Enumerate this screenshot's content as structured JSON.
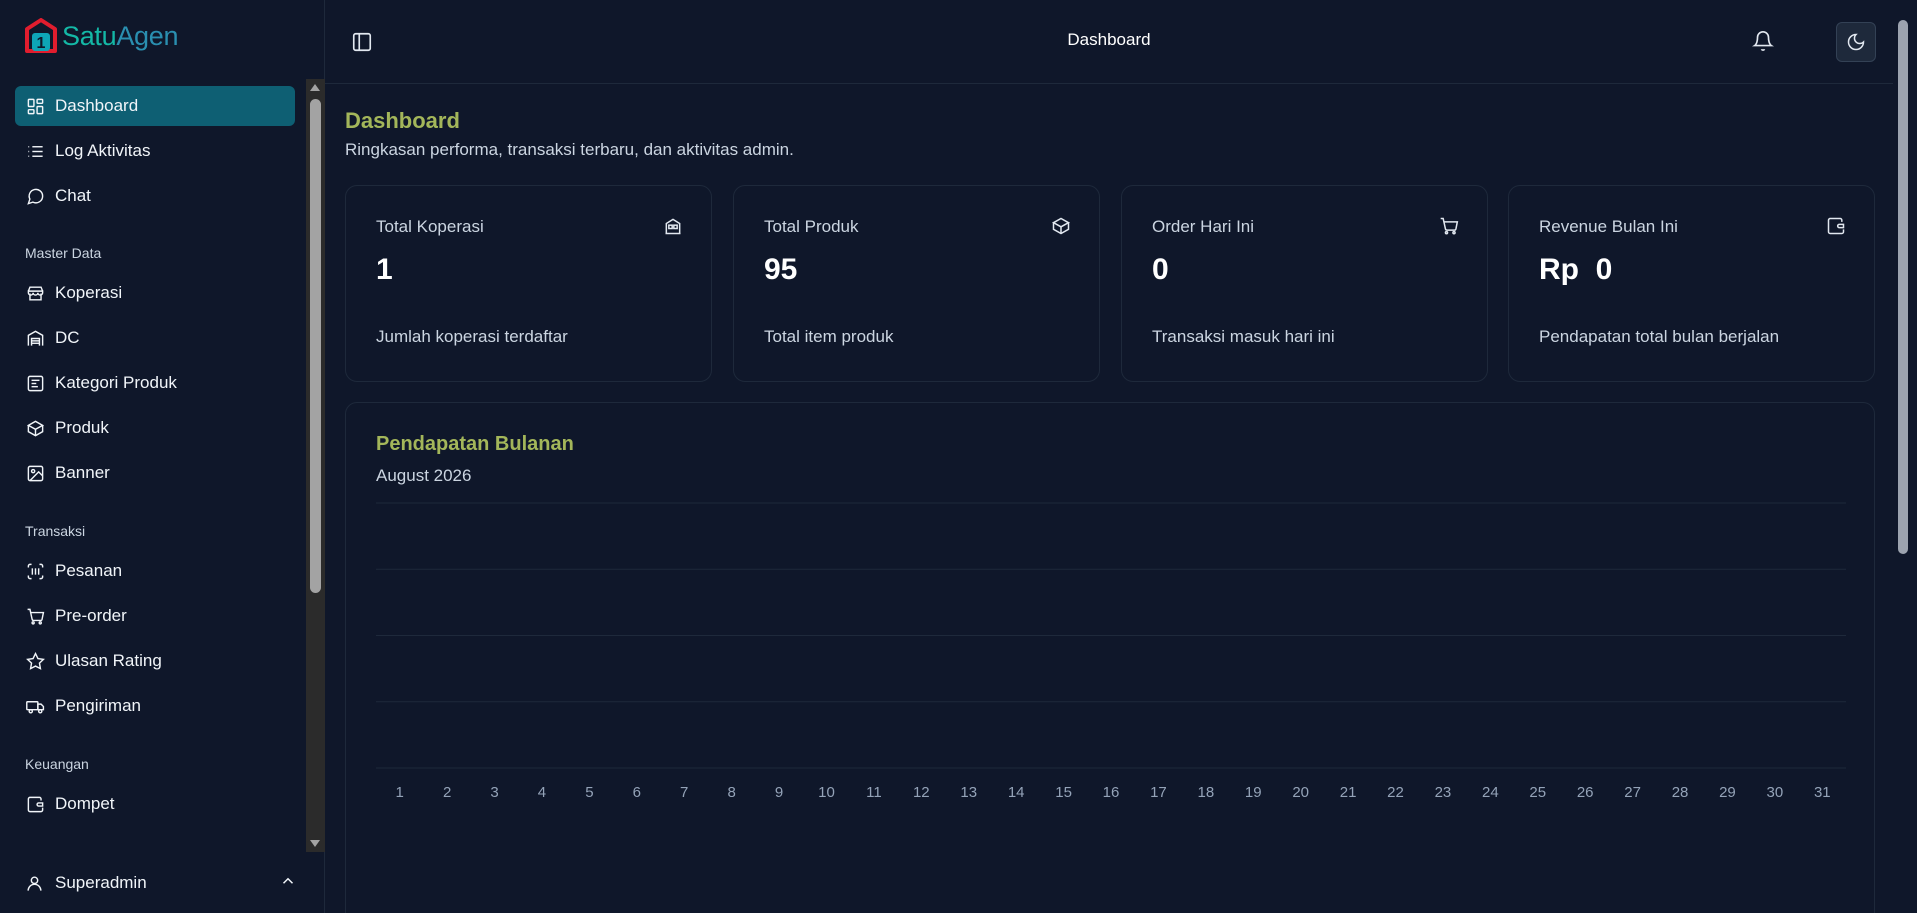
{
  "app": {
    "logo_text_1": "Satu",
    "logo_text_2": "Agen",
    "logo_digit": "1"
  },
  "sidebar": {
    "items_top": [
      {
        "label": "Dashboard",
        "icon": "dashboard-icon",
        "active": true
      },
      {
        "label": "Log Aktivitas",
        "icon": "list-icon"
      },
      {
        "label": "Chat",
        "icon": "chat-icon"
      }
    ],
    "section_master": "Master Data",
    "items_master": [
      {
        "label": "Koperasi",
        "icon": "store-icon"
      },
      {
        "label": "DC",
        "icon": "warehouse-icon"
      },
      {
        "label": "Kategori Produk",
        "icon": "category-icon"
      },
      {
        "label": "Produk",
        "icon": "box-icon"
      },
      {
        "label": "Banner",
        "icon": "image-icon"
      }
    ],
    "section_transaksi": "Transaksi",
    "items_transaksi": [
      {
        "label": "Pesanan",
        "icon": "scan-icon"
      },
      {
        "label": "Pre-order",
        "icon": "cart-icon"
      },
      {
        "label": "Ulasan Rating",
        "icon": "star-icon"
      },
      {
        "label": "Pengiriman",
        "icon": "truck-icon"
      }
    ],
    "section_keuangan": "Keuangan",
    "items_keuangan": [
      {
        "label": "Dompet",
        "icon": "wallet-icon"
      }
    ],
    "user_label": "Superadmin"
  },
  "header": {
    "title": "Dashboard"
  },
  "main": {
    "title": "Dashboard",
    "subtitle": "Ringkasan performa, transaksi terbaru, dan aktivitas admin.",
    "cards": [
      {
        "label": "Total Koperasi",
        "value": "1",
        "desc": "Jumlah koperasi terdaftar",
        "icon": "building-icon"
      },
      {
        "label": "Total Produk",
        "value": "95",
        "desc": "Total item produk",
        "icon": "box-icon"
      },
      {
        "label": "Order Hari Ini",
        "value": "0",
        "desc": "Transaksi masuk hari ini",
        "icon": "cart-icon"
      },
      {
        "label": "Revenue Bulan Ini",
        "value": "Rp  0",
        "desc": "Pendapatan total bulan berjalan",
        "icon": "wallet-icon"
      }
    ],
    "chart_title": "Pendapatan Bulanan",
    "chart_subtitle": "August 2026"
  },
  "chart_data": {
    "type": "bar",
    "title": "Pendapatan Bulanan",
    "subtitle": "August 2026",
    "categories": [
      "1",
      "2",
      "3",
      "4",
      "5",
      "6",
      "7",
      "8",
      "9",
      "10",
      "11",
      "12",
      "13",
      "14",
      "15",
      "16",
      "17",
      "18",
      "19",
      "20",
      "21",
      "22",
      "23",
      "24",
      "25",
      "26",
      "27",
      "28",
      "29",
      "30",
      "31"
    ],
    "values": [
      0,
      0,
      0,
      0,
      0,
      0,
      0,
      0,
      0,
      0,
      0,
      0,
      0,
      0,
      0,
      0,
      0,
      0,
      0,
      0,
      0,
      0,
      0,
      0,
      0,
      0,
      0,
      0,
      0,
      0,
      0
    ],
    "grid": true,
    "xlabel": "",
    "ylabel": ""
  },
  "colors": {
    "accent": "#0e5f73",
    "title_green": "#a3b65a",
    "background": "#0f172a"
  }
}
